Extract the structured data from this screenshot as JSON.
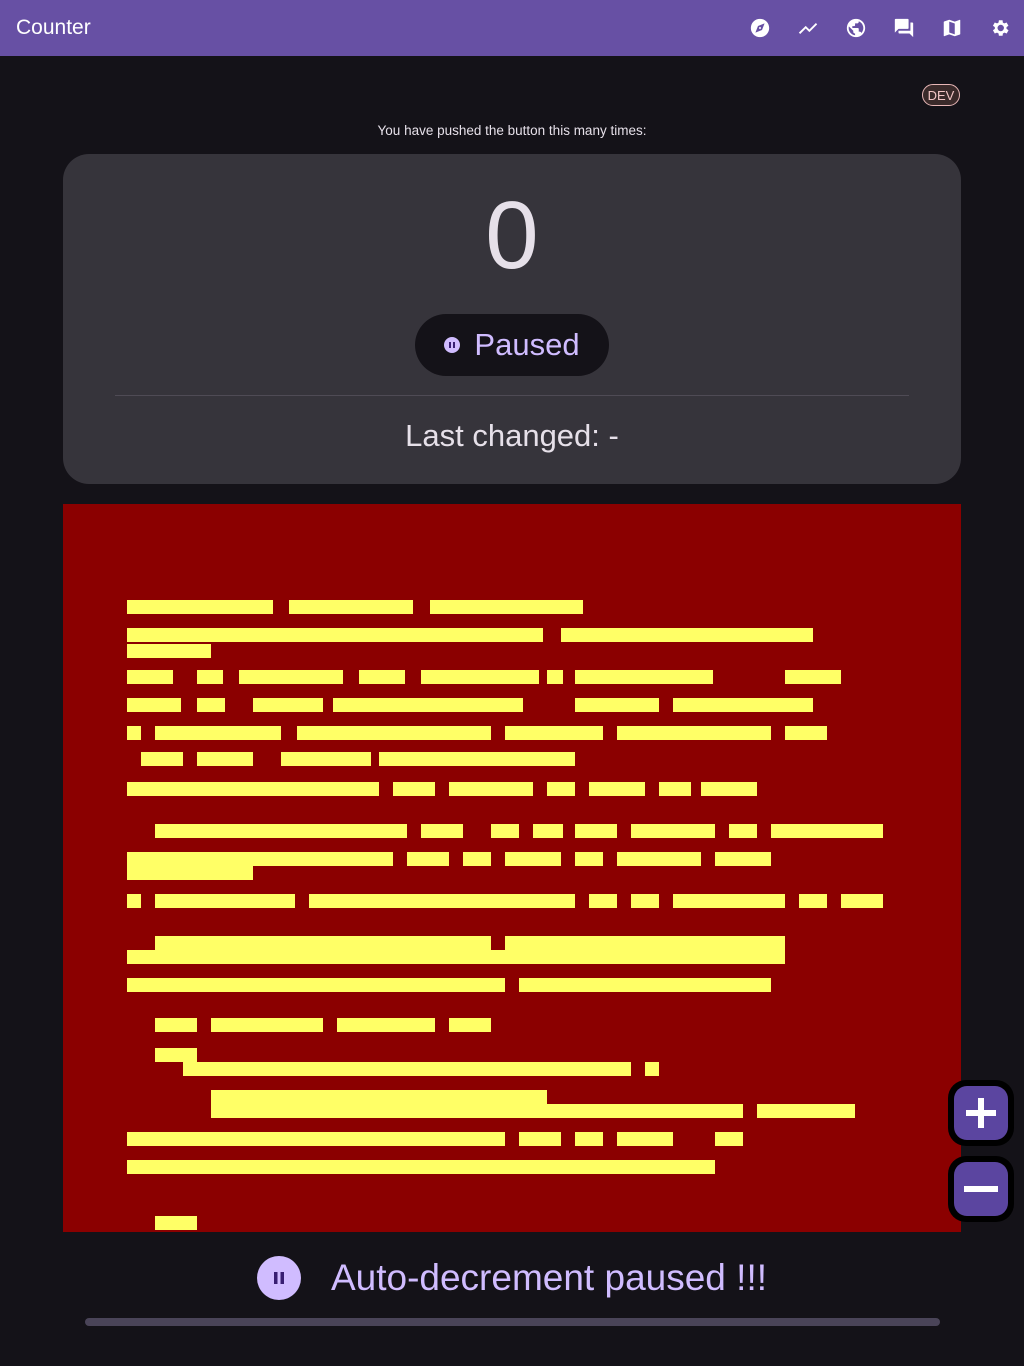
{
  "app": {
    "title": "Counter"
  },
  "toolbar": {
    "actions": [
      {
        "icon": "compass-icon",
        "name": "explore"
      },
      {
        "icon": "trending-up-icon",
        "name": "stats"
      },
      {
        "icon": "globe-icon",
        "name": "web"
      },
      {
        "icon": "forum-icon",
        "name": "chat"
      },
      {
        "icon": "map-icon",
        "name": "map"
      },
      {
        "icon": "gear-icon",
        "name": "settings"
      }
    ]
  },
  "badge": {
    "label": "DEV"
  },
  "counter": {
    "caption": "You have pushed the button this many times:",
    "value": "0",
    "status": "Paused",
    "last_changed": "Last changed: -"
  },
  "fabs": {
    "increment_icon": "plus-icon",
    "decrement_icon": "minus-icon"
  },
  "auto_decrement": {
    "label": "Auto-decrement paused !!!",
    "progress": 0
  },
  "colors": {
    "appbar": "#6750a4",
    "background": "#141218",
    "card": "#36343b",
    "accent": "#d0bcff",
    "glitch_bg": "#8b0000",
    "glitch_fg": "#ffff66"
  }
}
